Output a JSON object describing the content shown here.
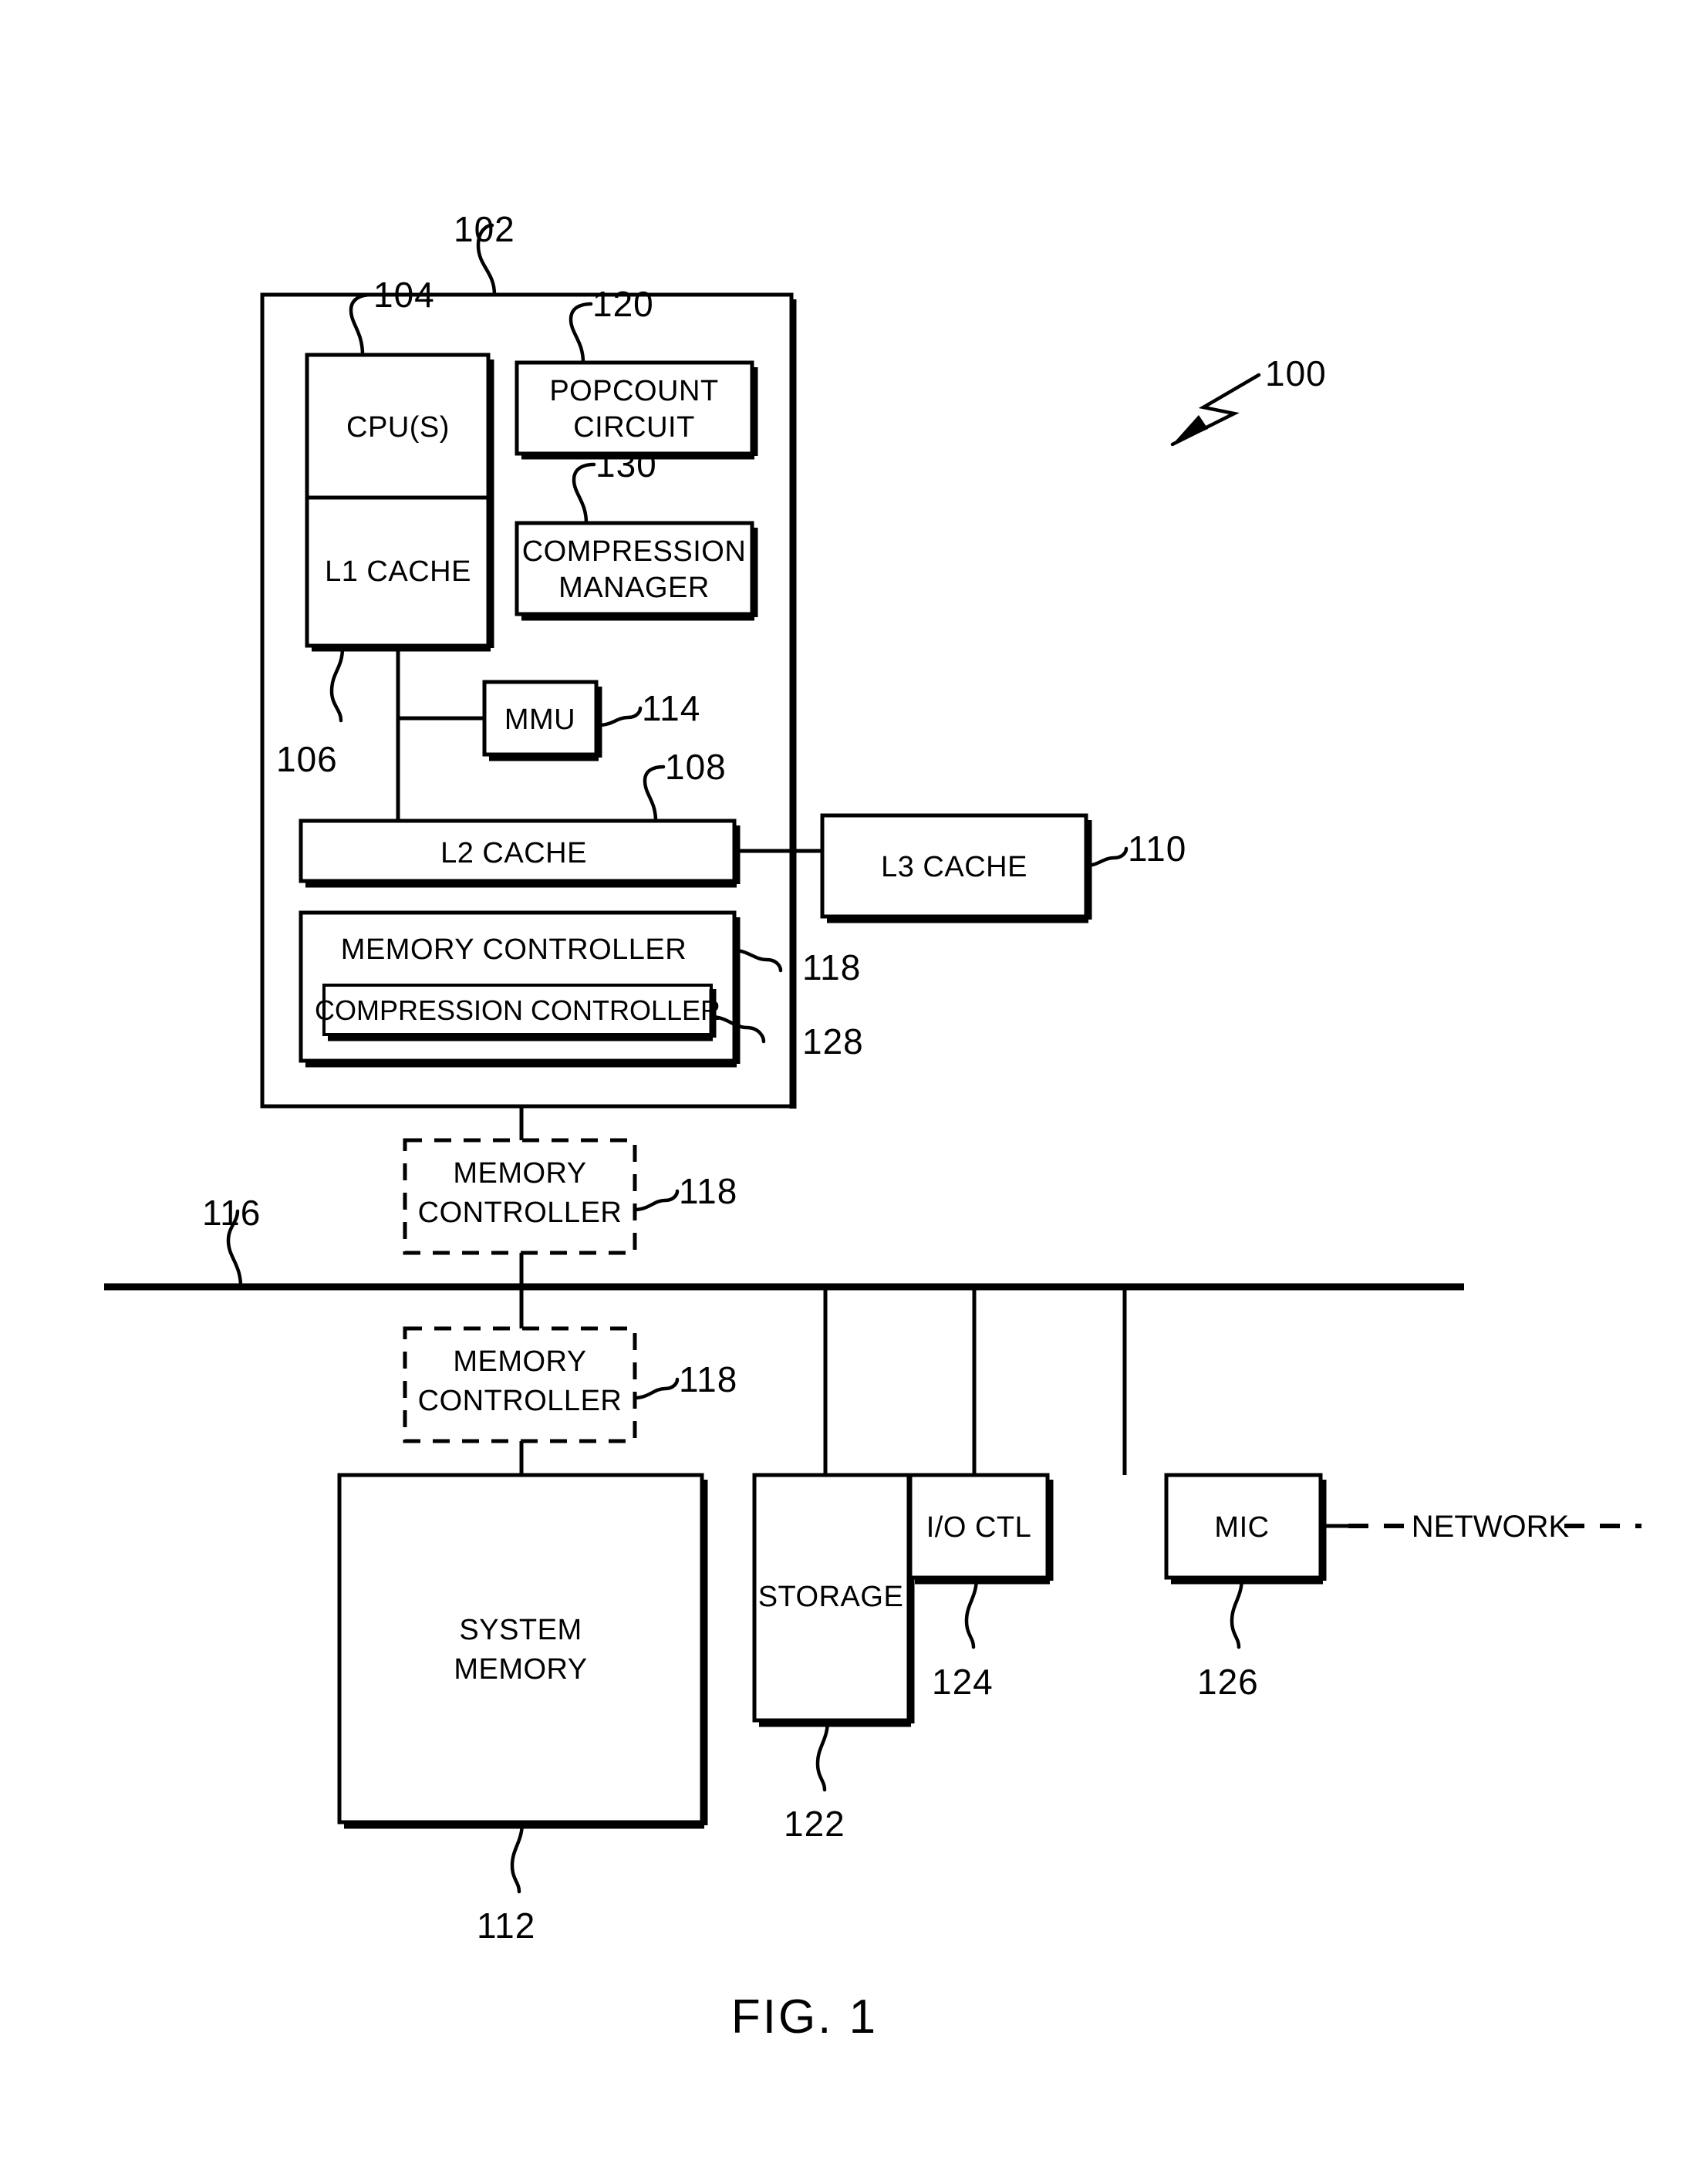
{
  "figure": {
    "caption": "FIG. 1",
    "system_ref": "100"
  },
  "blocks": {
    "soc": {
      "ref": "102"
    },
    "cpus": {
      "label": "CPU(S)",
      "ref": "104"
    },
    "l1_cache": {
      "label": "L1 CACHE",
      "ref": "106"
    },
    "popcount": {
      "label_line1": "POPCOUNT",
      "label_line2": "CIRCUIT",
      "ref": "120"
    },
    "compression_manager": {
      "label_line1": "COMPRESSION",
      "label_line2": "MANAGER",
      "ref": "130"
    },
    "mmu": {
      "label": "MMU",
      "ref": "114"
    },
    "l2_cache": {
      "label": "L2 CACHE",
      "ref": "108"
    },
    "l3_cache": {
      "label": "L3 CACHE",
      "ref": "110"
    },
    "memory_controller_internal": {
      "label": "MEMORY CONTROLLER",
      "ref": "118"
    },
    "compression_controller": {
      "label": "COMPRESSION CONTROLLER",
      "ref": "128"
    },
    "memory_controller_above_bus": {
      "label_line1": "MEMORY",
      "label_line2": "CONTROLLER",
      "ref": "118"
    },
    "memory_controller_below_bus": {
      "label_line1": "MEMORY",
      "label_line2": "CONTROLLER",
      "ref": "118"
    },
    "bus": {
      "ref": "116"
    },
    "system_memory": {
      "label_line1": "SYSTEM",
      "label_line2": "MEMORY",
      "ref": "112"
    },
    "storage": {
      "label": "STORAGE",
      "ref": "122"
    },
    "io_ctl": {
      "label": "I/O CTL",
      "ref": "124"
    },
    "mic": {
      "label": "MIC",
      "ref": "126"
    },
    "network": {
      "label": "NETWORK"
    }
  },
  "colors": {
    "stroke": "#000000",
    "background": "#ffffff"
  }
}
